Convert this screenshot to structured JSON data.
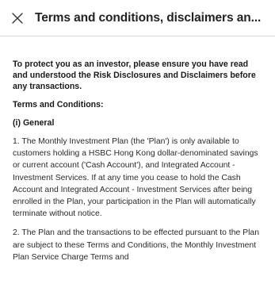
{
  "header": {
    "title": "Terms and conditions, disclaimers an..."
  },
  "content": {
    "intro": "To protect you as an investor, please ensure you have read and understood the Risk Disclosures and Disclaimers before any transactions.",
    "terms_heading": "Terms and Conditions:",
    "section_heading": "(i) General",
    "paragraphs": [
      "1. The Monthly Investment Plan (the 'Plan') is only available to customers holding a HSBC Hong Kong dollar-denominated savings or current account ('Cash Account'), and Integrated Account - Investment Services. If at any time you cease to hold the Cash Account and Integrated Account - Investment Services after being enrolled in the Plan, your participation in the Plan will automatically terminate without notice.",
      "2. The Plan and the transactions to be effected pursuant to the Plan are subject to these Terms and Conditions, the Monthly Investment Plan Service Charge Terms and"
    ]
  }
}
